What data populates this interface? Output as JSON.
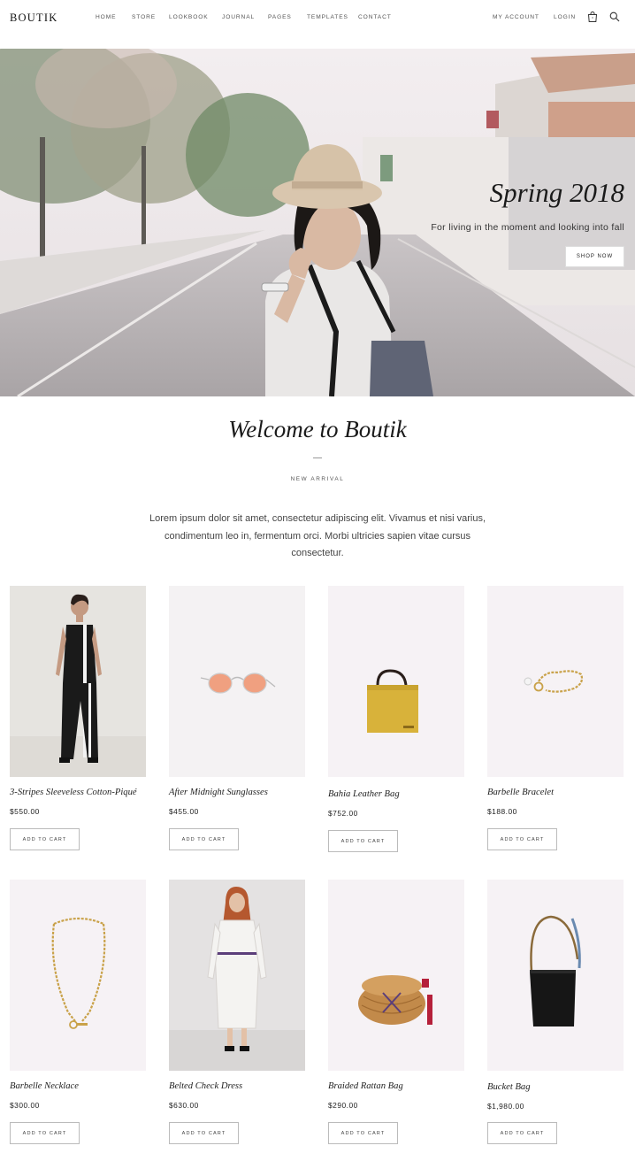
{
  "header": {
    "logo": "BOUTIK",
    "nav": [
      "HOME",
      "STORE",
      "LOOKBOOK",
      "JOURNAL",
      "PAGES",
      "TEMPLATES",
      "CONTACT"
    ],
    "my_account": "MY ACCOUNT",
    "login": "LOGIN",
    "icons": [
      "shopping-bag-icon",
      "search-icon"
    ]
  },
  "hero": {
    "title": "Spring 2018",
    "subtitle": "For living in the moment and looking into fall",
    "button": "SHOP NOW"
  },
  "welcome": {
    "title": "Welcome to Boutik",
    "subtitle": "NEW ARRIVAL",
    "text": "Lorem ipsum dolor sit amet, consectetur adipiscing elit. Vivamus et nisi varius, condimentum leo in, fermentum orci. Morbi ultricies sapien vitae cursus consectetur."
  },
  "products": [
    {
      "name": "3-Stripes Sleeveless Cotton-Piqué",
      "price": "$550.00",
      "button": "ADD TO CART"
    },
    {
      "name": "After Midnight Sunglasses",
      "price": "$455.00",
      "button": "ADD TO CART"
    },
    {
      "name": "Bahia Leather Bag",
      "price": "$752.00",
      "button": "ADD TO CART"
    },
    {
      "name": "Barbelle Bracelet",
      "price": "$188.00",
      "button": "ADD TO CART"
    },
    {
      "name": "Barbelle Necklace",
      "price": "$300.00",
      "button": "ADD TO CART"
    },
    {
      "name": "Belted Check Dress",
      "price": "$630.00",
      "button": "ADD TO CART"
    },
    {
      "name": "Braided Rattan Bag",
      "price": "$290.00",
      "button": "ADD TO CART"
    },
    {
      "name": "Bucket Bag",
      "price": "$1,980.00",
      "button": "ADD TO CART"
    }
  ],
  "colors": {
    "text": "#222222",
    "product_bg": "#f6f2f5",
    "border": "#bbbbbb"
  }
}
